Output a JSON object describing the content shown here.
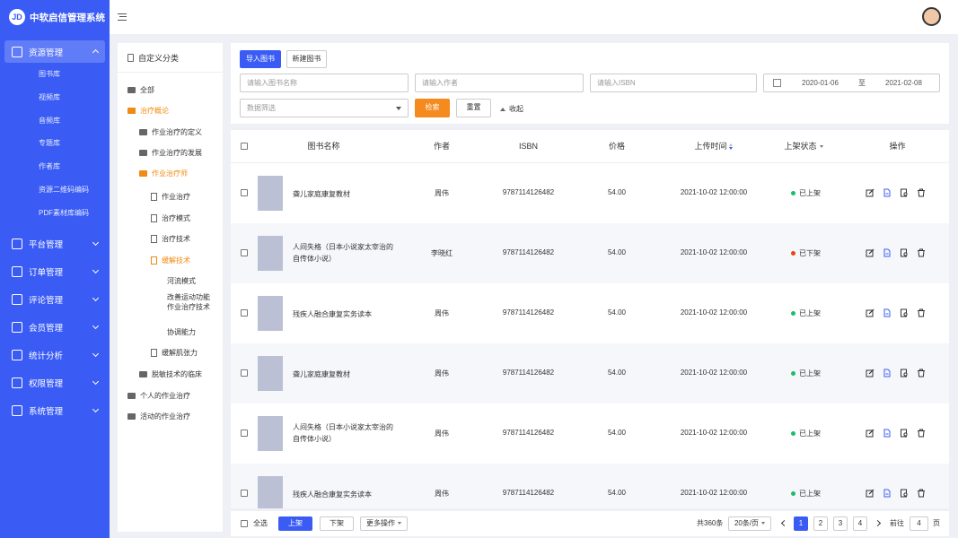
{
  "app": {
    "title": "中软启信管理系统",
    "logo_glyph": "JD"
  },
  "sidebar": {
    "active_group": {
      "label": "资源管理",
      "icon": "resource-icon"
    },
    "sub_items": [
      "图书库",
      "视频库",
      "音频库",
      "专题库",
      "作者库",
      "资源二维码编码",
      "PDF素材库编码"
    ],
    "items": [
      {
        "label": "平台管理",
        "icon": "platform-icon"
      },
      {
        "label": "订单管理",
        "icon": "order-icon"
      },
      {
        "label": "评论管理",
        "icon": "comment-icon"
      },
      {
        "label": "会员管理",
        "icon": "member-icon"
      },
      {
        "label": "统计分析",
        "icon": "stats-icon"
      },
      {
        "label": "权限管理",
        "icon": "permission-icon"
      },
      {
        "label": "系统管理",
        "icon": "settings-icon"
      }
    ]
  },
  "tree": {
    "header": "自定义分类",
    "nodes": [
      {
        "label": "全部",
        "type": "folder",
        "state": "normal"
      },
      {
        "label": "治疗概论",
        "type": "folder",
        "state": "active"
      },
      {
        "label": "作业治疗的定义",
        "type": "folder",
        "state": "normal"
      },
      {
        "label": "作业治疗的发展",
        "type": "folder",
        "state": "normal"
      },
      {
        "label": "作业治疗师",
        "type": "folder",
        "state": "active"
      },
      {
        "label": "作业治疗",
        "type": "doc",
        "state": "normal"
      },
      {
        "label": "治疗模式",
        "type": "doc",
        "state": "normal"
      },
      {
        "label": "治疗技术",
        "type": "doc",
        "state": "normal"
      },
      {
        "label": "缓解技术",
        "type": "doc",
        "state": "active"
      },
      {
        "label": "河流模式",
        "type": "text",
        "state": "normal"
      },
      {
        "label": "改善运动功能作业治疗技术",
        "type": "text",
        "state": "normal"
      },
      {
        "label": "协调能力",
        "type": "text",
        "state": "normal"
      },
      {
        "label": "缓解肌张力",
        "type": "doc",
        "state": "normal"
      },
      {
        "label": "脱敏技术的临床",
        "type": "folder",
        "state": "normal"
      },
      {
        "label": "个人的作业治疗",
        "type": "folder",
        "state": "normal"
      },
      {
        "label": "活动的作业治疗",
        "type": "folder",
        "state": "normal"
      }
    ]
  },
  "toolbar": {
    "import_label": "导入图书",
    "new_label": "新建图书",
    "search_label": "检索",
    "reset_label": "重置",
    "collapse_label": "收起"
  },
  "filters": {
    "name_placeholder": "请输入图书名称",
    "author_placeholder": "请输入作者",
    "isbn_placeholder": "请输入ISBN",
    "date_from": "2020-01-06",
    "date_sep": "至",
    "date_to": "2021-02-08",
    "data_select": "数据筛选"
  },
  "table": {
    "headers": {
      "name": "图书名称",
      "author": "作者",
      "isbn": "ISBN",
      "price": "价格",
      "upload_time": "上传时间",
      "status": "上架状态",
      "ops": "操作"
    },
    "rows": [
      {
        "name": "聋儿家庭康复教材",
        "author": "周伟",
        "isbn": "9787114126482",
        "price": "54.00",
        "time": "2021-10-02 12:00:00",
        "status": "已上架",
        "status_color": "#19be6b"
      },
      {
        "name": "人间失格（日本小说家太宰治的自传体小说）",
        "author": "李晓红",
        "isbn": "9787114126482",
        "price": "54.00",
        "time": "2021-10-02 12:00:00",
        "status": "已下架",
        "status_color": "#ed4014"
      },
      {
        "name": "残疾人融合康复实务读本",
        "author": "周伟",
        "isbn": "9787114126482",
        "price": "54.00",
        "time": "2021-10-02 12:00:00",
        "status": "已上架",
        "status_color": "#19be6b"
      },
      {
        "name": "聋儿家庭康复教材",
        "author": "周伟",
        "isbn": "9787114126482",
        "price": "54.00",
        "time": "2021-10-02 12:00:00",
        "status": "已上架",
        "status_color": "#19be6b"
      },
      {
        "name": "人间失格（日本小说家太宰治的自传体小说）",
        "author": "周伟",
        "isbn": "9787114126482",
        "price": "54.00",
        "time": "2021-10-02 12:00:00",
        "status": "已上架",
        "status_color": "#19be6b"
      },
      {
        "name": "残疾人融合康复实务读本",
        "author": "周伟",
        "isbn": "9787114126482",
        "price": "54.00",
        "time": "2021-10-02 12:00:00",
        "status": "已上架",
        "status_color": "#19be6b"
      }
    ]
  },
  "footer": {
    "select_all": "全选",
    "shelve": "上架",
    "unshelve": "下架",
    "more_ops": "更多操作",
    "total": "共360条",
    "page_size": "20条/页",
    "pages": [
      "1",
      "2",
      "3",
      "4"
    ],
    "current_page": "1",
    "goto_prefix": "前往",
    "goto_value": "4",
    "goto_suffix": "页"
  },
  "colors": {
    "accent": "#3a5cf5",
    "orange": "#f58a1f"
  }
}
